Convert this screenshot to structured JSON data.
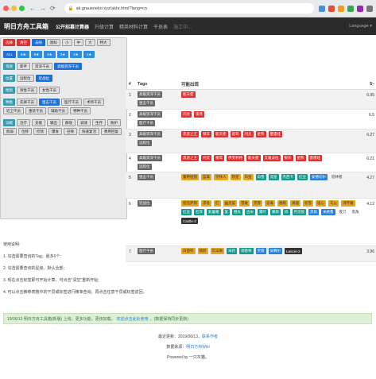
{
  "browser": {
    "url": "ak.graueneko.xyz/akhr.html?lang=cn"
  },
  "navbar": {
    "brand": "明日方舟工具箱",
    "items": [
      {
        "label": "公开招募计算器",
        "active": true
      },
      {
        "label": "升级计算",
        "active": false
      },
      {
        "label": "精英材料计算",
        "active": false
      },
      {
        "label": "干员表",
        "active": false
      },
      {
        "label": "施工中...",
        "active": false,
        "disabled": true
      }
    ],
    "language": "Language"
  },
  "filter": {
    "rows": [
      {
        "label": "选择",
        "label_color": "#e02f2f",
        "tags": [
          {
            "t": "清空",
            "style": "red"
          },
          {
            "t": "去除",
            "style": "sel"
          },
          {
            "t": "图标",
            "style": ""
          },
          {
            "t": "小",
            "style": ""
          },
          {
            "t": "中",
            "style": ""
          },
          {
            "t": "大",
            "style": ""
          },
          {
            "t": "特大",
            "style": ""
          }
        ]
      },
      {
        "label": "",
        "label_color": "",
        "tags": [
          {
            "t": "ALL",
            "style": "sel"
          },
          {
            "t": "6★",
            "style": "blue"
          },
          {
            "t": "5★",
            "style": "blue"
          },
          {
            "t": "4★",
            "style": "blue"
          },
          {
            "t": "3★",
            "style": "blue"
          },
          {
            "t": "2★",
            "style": "blue"
          },
          {
            "t": "1★",
            "style": "blue"
          }
        ]
      },
      {
        "label": "资质",
        "label_color": "#3a9bb0",
        "tags": [
          {
            "t": "新手",
            "style": ""
          },
          {
            "t": "资深干员",
            "style": ""
          },
          {
            "t": "高级资深干员",
            "style": "sel"
          }
        ]
      },
      {
        "label": "位置",
        "label_color": "#3a9bb0",
        "tags": [
          {
            "t": "远程位",
            "style": ""
          },
          {
            "t": "近战位",
            "style": "sel"
          }
        ]
      },
      {
        "label": "性别",
        "label_color": "#3a9bb0",
        "tags": [
          {
            "t": "男性干员",
            "style": ""
          },
          {
            "t": "女性干员",
            "style": ""
          }
        ]
      },
      {
        "label": "种类",
        "label_color": "#3a9bb0",
        "tags": [
          {
            "t": "先锋干员",
            "style": ""
          },
          {
            "t": "狙击干员",
            "style": "sel"
          },
          {
            "t": "医疗干员",
            "style": ""
          },
          {
            "t": "术师干员",
            "style": ""
          },
          {
            "t": "近卫干员",
            "style": ""
          },
          {
            "t": "重装干员",
            "style": ""
          },
          {
            "t": "辅助干员",
            "style": ""
          },
          {
            "t": "特种干员",
            "style": ""
          }
        ]
      },
      {
        "label": "词缀",
        "label_color": "#3a9bb0",
        "tags": [
          {
            "t": "治疗",
            "style": ""
          },
          {
            "t": "支援",
            "style": ""
          },
          {
            "t": "输出",
            "style": ""
          },
          {
            "t": "群攻",
            "style": ""
          },
          {
            "t": "减速",
            "style": ""
          },
          {
            "t": "生存",
            "style": ""
          },
          {
            "t": "防护",
            "style": ""
          },
          {
            "t": "削弱",
            "style": ""
          },
          {
            "t": "位移",
            "style": ""
          },
          {
            "t": "控场",
            "style": ""
          },
          {
            "t": "爆发",
            "style": ""
          },
          {
            "t": "召唤",
            "style": ""
          },
          {
            "t": "快速复活",
            "style": ""
          },
          {
            "t": "费用回复",
            "style": ""
          }
        ]
      }
    ]
  },
  "results": {
    "headers": [
      "#",
      "Tags",
      "可能出现",
      "$~"
    ],
    "rows": [
      {
        "num": "1",
        "tags": [
          "高级资深干员",
          "狙击干员"
        ],
        "ops": [
          {
            "n": "能天使",
            "r": 6
          }
        ],
        "val": "6.95"
      },
      {
        "num": "2",
        "tags": [
          "高级资深干员",
          "医疗干员"
        ],
        "ops": [
          {
            "n": "闪灵",
            "r": 6
          },
          {
            "n": "夜莺",
            "r": 6
          }
        ],
        "val": "6.5"
      },
      {
        "num": "3",
        "tags": [
          "高级资深干员",
          "远程位"
        ],
        "ops": [
          {
            "n": "黑恶之王",
            "r": 6
          },
          {
            "n": "银灰",
            "r": 6
          },
          {
            "n": "能天使",
            "r": 6
          },
          {
            "n": "夜莺",
            "r": 6
          },
          {
            "n": "闪灵",
            "r": 6
          },
          {
            "n": "星熊",
            "r": 6
          },
          {
            "n": "塞雷娅",
            "r": 6
          }
        ],
        "val": "6.27"
      },
      {
        "num": "4",
        "tags": [
          "高级资深干员",
          "远程位"
        ],
        "ops": [
          {
            "n": "黑恶之王",
            "r": 6
          },
          {
            "n": "闪灵",
            "r": 6
          },
          {
            "n": "夜莺",
            "r": 6
          },
          {
            "n": "伊芙利特",
            "r": 6
          },
          {
            "n": "能天使",
            "r": 6
          },
          {
            "n": "艾雅法拉",
            "r": 6
          },
          {
            "n": "银灰",
            "r": 6
          },
          {
            "n": "星熊",
            "r": 6
          },
          {
            "n": "塞雷娅",
            "r": 6
          }
        ],
        "val": "6.21"
      },
      {
        "num": "5",
        "tags": [
          "狙击干员"
        ],
        "ops": [
          {
            "n": "蕾蒂娅丽",
            "r": 5
          },
          {
            "n": "蓝毒",
            "r": 5
          },
          {
            "n": "守林人",
            "r": 5
          },
          {
            "n": "陨星",
            "r": 5
          },
          {
            "n": "白金",
            "r": 5
          },
          {
            "n": "白雪",
            "r": 4
          },
          {
            "n": "流星",
            "r": 4
          },
          {
            "n": "杰西卡",
            "r": 4
          },
          {
            "n": "红豆",
            "r": 4
          },
          {
            "n": "安德切尔",
            "r": 3
          },
          {
            "n": "巡林者",
            "r": 0
          }
        ],
        "val": "4.27"
      },
      {
        "num": "6",
        "tags": [
          "近战位"
        ],
        "ops": [
          {
            "n": "德克萨斯",
            "r": 5
          },
          {
            "n": "凛冬",
            "r": 5
          },
          {
            "n": "红",
            "r": 5
          },
          {
            "n": "幽灵鲨",
            "r": 5
          },
          {
            "n": "雪雉",
            "r": 5
          },
          {
            "n": "芙蓉",
            "r": 5
          },
          {
            "n": "蓝毒",
            "r": 5
          },
          {
            "n": "赫默",
            "r": 5
          },
          {
            "n": "真理",
            "r": 5
          },
          {
            "n": "初雪",
            "r": 5
          },
          {
            "n": "崖心",
            "r": 5
          },
          {
            "n": "天火",
            "r": 5
          },
          {
            "n": "诗怀雅",
            "r": 5
          },
          {
            "n": "红豆",
            "r": 4
          },
          {
            "n": "杜宾",
            "r": 4
          },
          {
            "n": "蛇屠箱",
            "r": 4
          },
          {
            "n": "宴",
            "r": 4
          },
          {
            "n": "缠丸",
            "r": 4
          },
          {
            "n": "古米",
            "r": 4
          },
          {
            "n": "霜叶",
            "r": 4
          },
          {
            "n": "慕斯",
            "r": 4
          },
          {
            "n": "砾",
            "r": 4
          },
          {
            "n": "月见夜",
            "r": 4
          },
          {
            "n": "黑角",
            "r": 3
          },
          {
            "n": "米格鲁",
            "r": 3
          },
          {
            "n": "夜刀",
            "r": 0
          },
          {
            "n": "黑角",
            "r": 0
          },
          {
            "n": "Castle-3",
            "r": 1
          }
        ],
        "val": "4.12"
      },
      {
        "num": "7",
        "tags": [
          "医疗干员"
        ],
        "ops": [
          {
            "n": "白面鸮",
            "r": 5
          },
          {
            "n": "赫默",
            "r": 5
          },
          {
            "n": "华法琳",
            "r": 5
          },
          {
            "n": "末药",
            "r": 4
          },
          {
            "n": "调香师",
            "r": 4
          },
          {
            "n": "芙蓉",
            "r": 3
          },
          {
            "n": "安赛尔",
            "r": 3
          },
          {
            "n": "Lancet-2",
            "r": 1
          }
        ],
        "val": "3.96"
      }
    ]
  },
  "usage": {
    "title": "使用说明:",
    "items": [
      "1. 勾选需要查询的Tag。最多6个;",
      "2. 勾选需要查询的星级。默认全部;",
      "3. 现在点击标签即可开始计算。可点击\"清空\"重新开始;",
      "4. 可以点击推荐表格中的干员或标签进行精准查询。再点击任意干员或标签返回。"
    ]
  },
  "notice": {
    "text": "19/06/13 明日方舟工具箱(新版) 上线。更多功能，更快加载。",
    "link": "欢迎点击此处使用",
    "tail": "。(数据保持同步更新)"
  },
  "footer": {
    "updated_prefix": "最近更新：2019/06/13，",
    "contact": "联系作者",
    "source_prefix": "数据来源：",
    "source_link": "明日方舟Wiki",
    "powered": "Powered by 一只灰猫。"
  }
}
